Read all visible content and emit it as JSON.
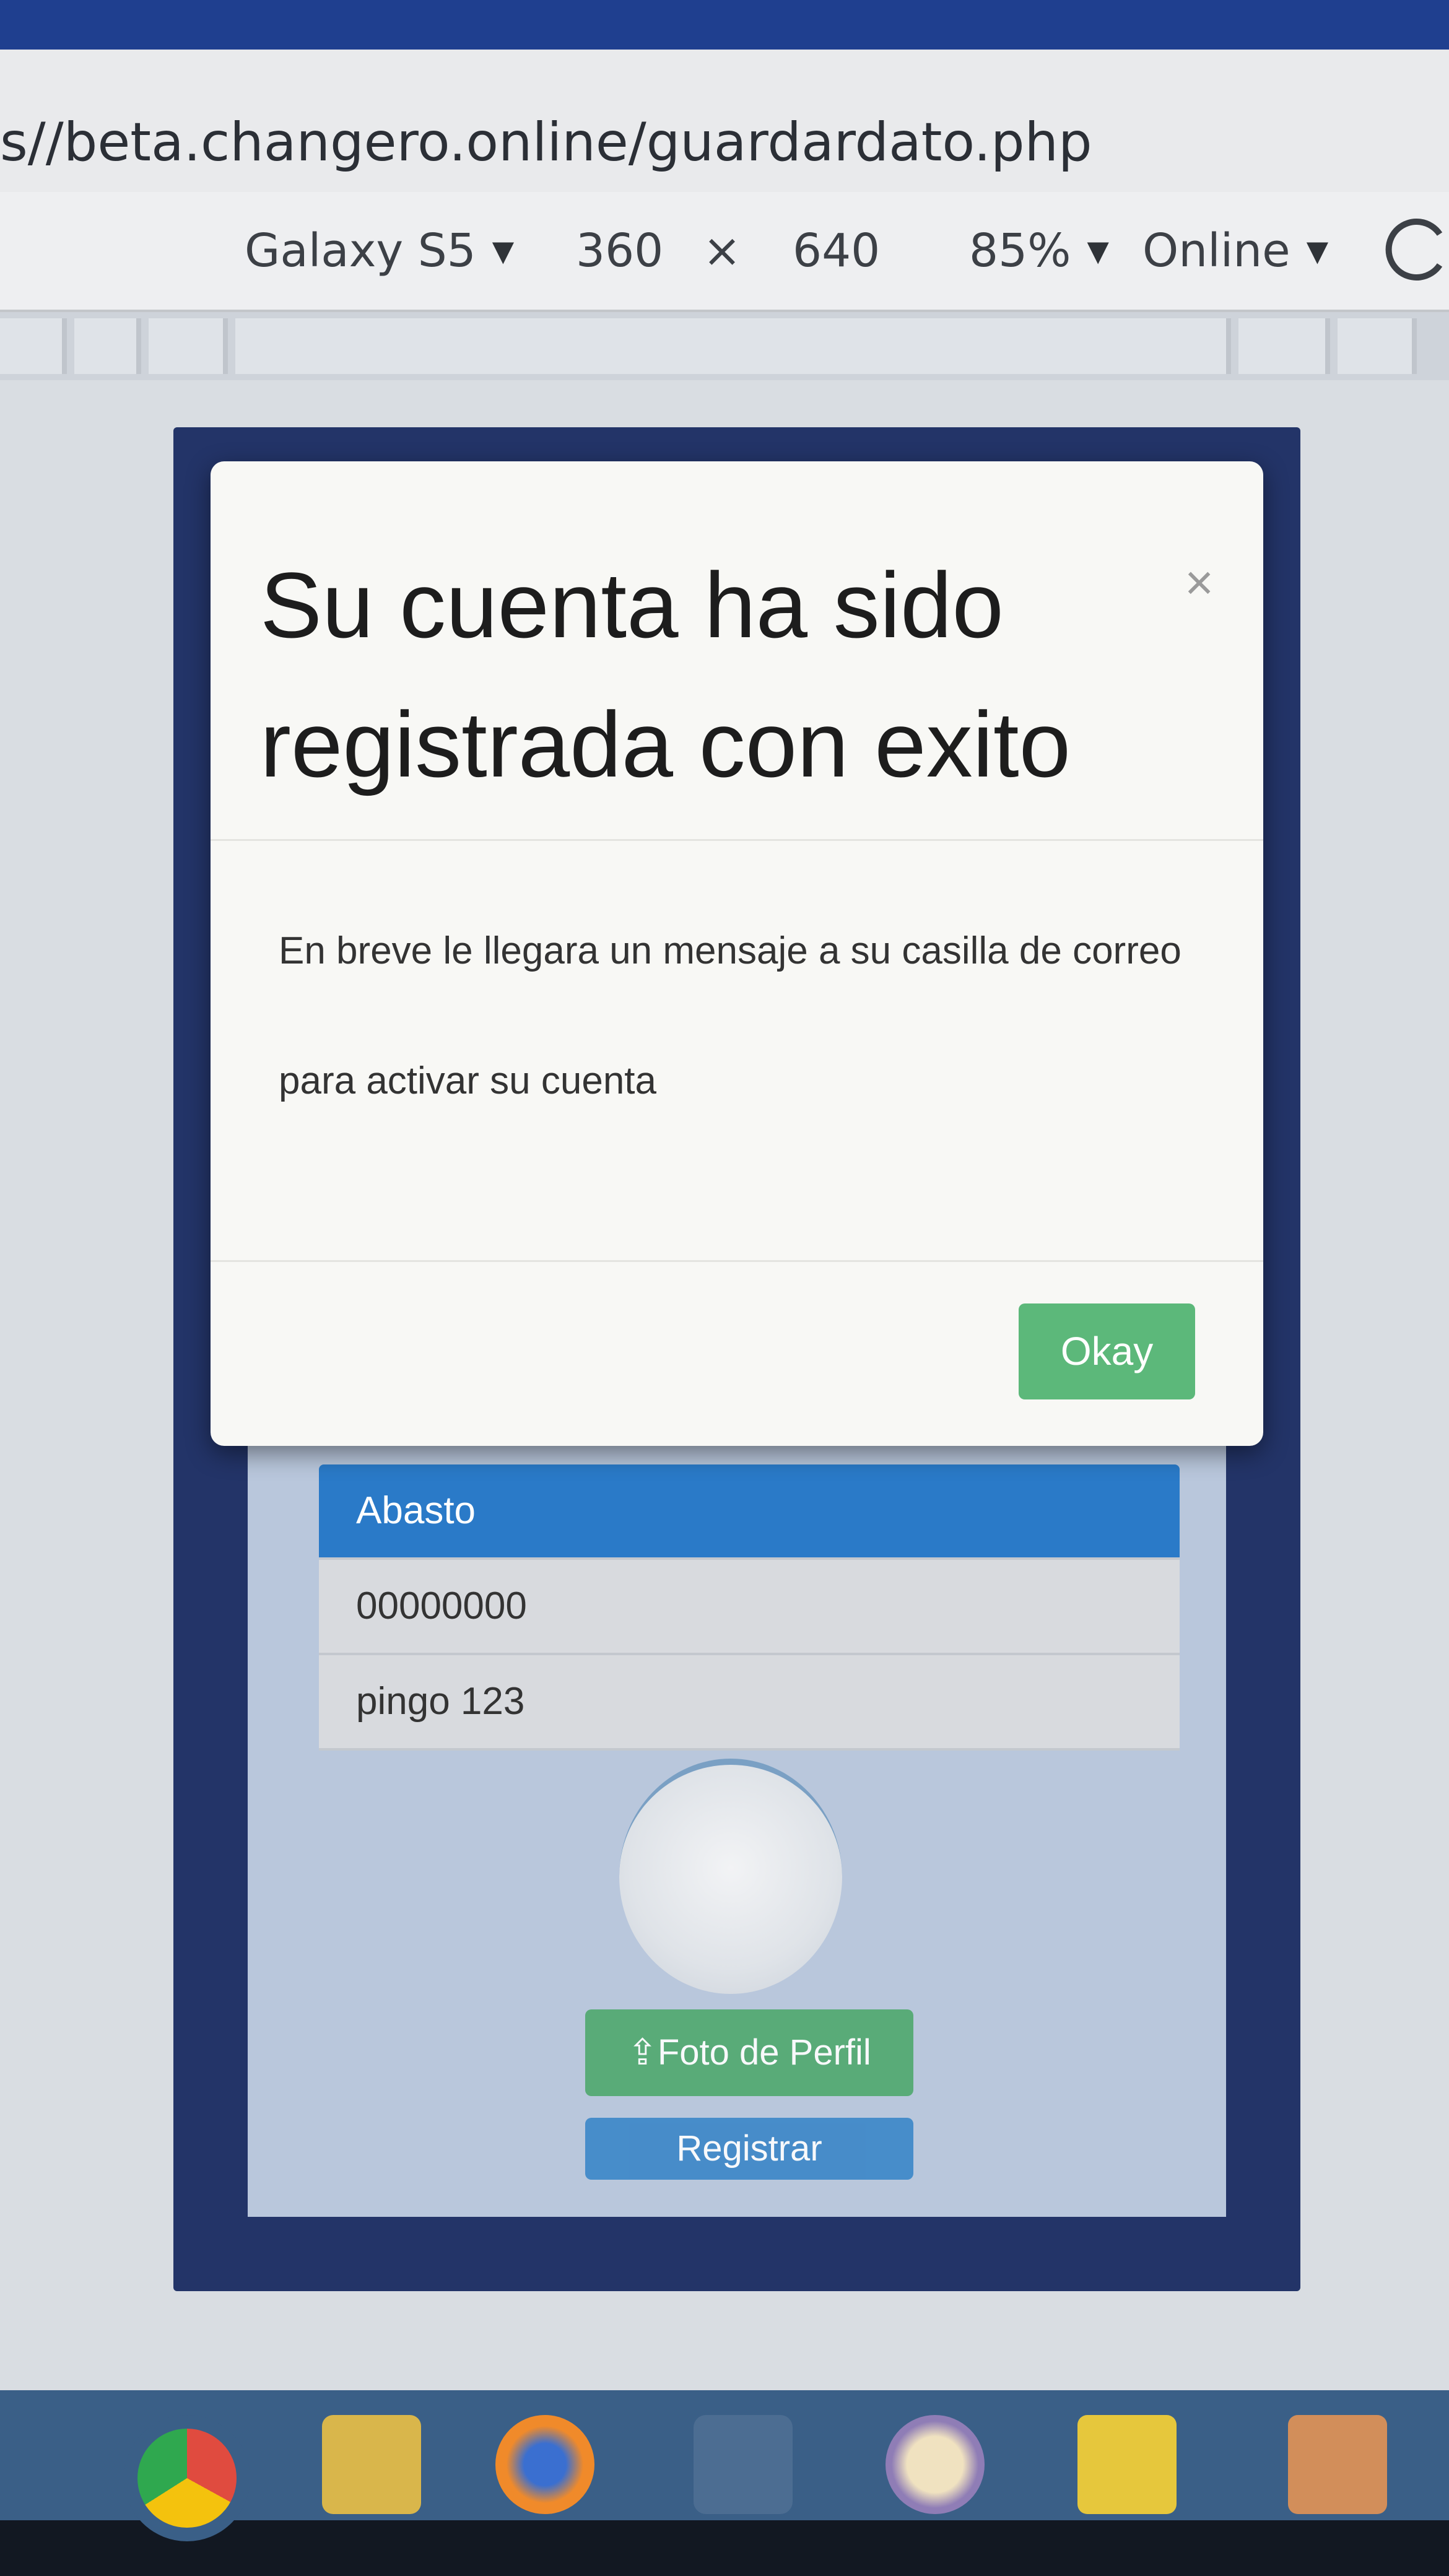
{
  "browser": {
    "url": "s//beta.changero.online/guardardato.php",
    "device": "Galaxy S5",
    "width": "360",
    "separator": "×",
    "height": "640",
    "zoom": "85%",
    "network": "Online"
  },
  "page": {
    "list_items": [
      "Abasto",
      "00000000",
      "pingo 123"
    ],
    "photo_button": "Foto de Perfil",
    "register_button": "Registrar"
  },
  "modal": {
    "title": "Su cuenta ha sido registrada con exito",
    "close": "×",
    "body_line1": "En breve le llegara un mensaje a su casilla de correo",
    "body_line2": "para activar su cuenta",
    "okay_button": "Okay"
  },
  "taskbar": {
    "icons": [
      "chrome-icon",
      "folder-icon",
      "firefox-icon",
      "dolphin-icon",
      "circle-app-icon",
      "sticky-notes-icon",
      "calendar-icon"
    ]
  },
  "colors": {
    "modal_ok": "#5cb87a",
    "list_active": "#2a7ac8",
    "frame": "#233468"
  }
}
